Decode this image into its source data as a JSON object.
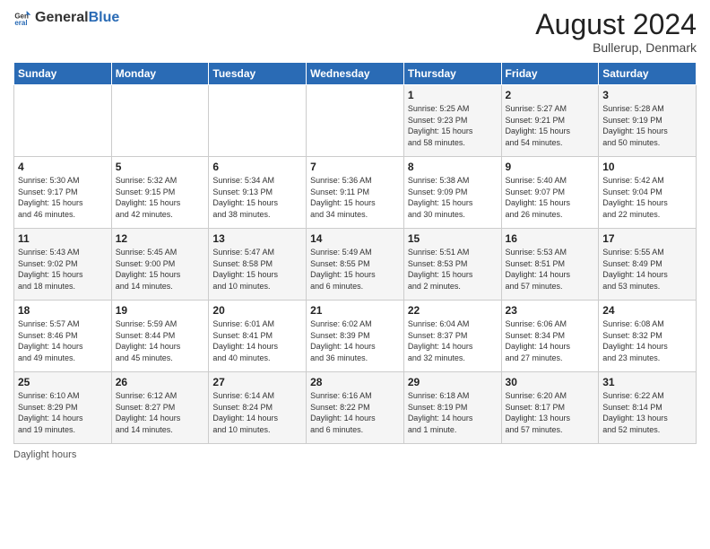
{
  "header": {
    "logo_general": "General",
    "logo_blue": "Blue",
    "month_year": "August 2024",
    "location": "Bullerup, Denmark"
  },
  "footer": {
    "daylight_label": "Daylight hours"
  },
  "days_of_week": [
    "Sunday",
    "Monday",
    "Tuesday",
    "Wednesday",
    "Thursday",
    "Friday",
    "Saturday"
  ],
  "weeks": [
    [
      {
        "day": "",
        "info": ""
      },
      {
        "day": "",
        "info": ""
      },
      {
        "day": "",
        "info": ""
      },
      {
        "day": "",
        "info": ""
      },
      {
        "day": "1",
        "info": "Sunrise: 5:25 AM\nSunset: 9:23 PM\nDaylight: 15 hours\nand 58 minutes."
      },
      {
        "day": "2",
        "info": "Sunrise: 5:27 AM\nSunset: 9:21 PM\nDaylight: 15 hours\nand 54 minutes."
      },
      {
        "day": "3",
        "info": "Sunrise: 5:28 AM\nSunset: 9:19 PM\nDaylight: 15 hours\nand 50 minutes."
      }
    ],
    [
      {
        "day": "4",
        "info": "Sunrise: 5:30 AM\nSunset: 9:17 PM\nDaylight: 15 hours\nand 46 minutes."
      },
      {
        "day": "5",
        "info": "Sunrise: 5:32 AM\nSunset: 9:15 PM\nDaylight: 15 hours\nand 42 minutes."
      },
      {
        "day": "6",
        "info": "Sunrise: 5:34 AM\nSunset: 9:13 PM\nDaylight: 15 hours\nand 38 minutes."
      },
      {
        "day": "7",
        "info": "Sunrise: 5:36 AM\nSunset: 9:11 PM\nDaylight: 15 hours\nand 34 minutes."
      },
      {
        "day": "8",
        "info": "Sunrise: 5:38 AM\nSunset: 9:09 PM\nDaylight: 15 hours\nand 30 minutes."
      },
      {
        "day": "9",
        "info": "Sunrise: 5:40 AM\nSunset: 9:07 PM\nDaylight: 15 hours\nand 26 minutes."
      },
      {
        "day": "10",
        "info": "Sunrise: 5:42 AM\nSunset: 9:04 PM\nDaylight: 15 hours\nand 22 minutes."
      }
    ],
    [
      {
        "day": "11",
        "info": "Sunrise: 5:43 AM\nSunset: 9:02 PM\nDaylight: 15 hours\nand 18 minutes."
      },
      {
        "day": "12",
        "info": "Sunrise: 5:45 AM\nSunset: 9:00 PM\nDaylight: 15 hours\nand 14 minutes."
      },
      {
        "day": "13",
        "info": "Sunrise: 5:47 AM\nSunset: 8:58 PM\nDaylight: 15 hours\nand 10 minutes."
      },
      {
        "day": "14",
        "info": "Sunrise: 5:49 AM\nSunset: 8:55 PM\nDaylight: 15 hours\nand 6 minutes."
      },
      {
        "day": "15",
        "info": "Sunrise: 5:51 AM\nSunset: 8:53 PM\nDaylight: 15 hours\nand 2 minutes."
      },
      {
        "day": "16",
        "info": "Sunrise: 5:53 AM\nSunset: 8:51 PM\nDaylight: 14 hours\nand 57 minutes."
      },
      {
        "day": "17",
        "info": "Sunrise: 5:55 AM\nSunset: 8:49 PM\nDaylight: 14 hours\nand 53 minutes."
      }
    ],
    [
      {
        "day": "18",
        "info": "Sunrise: 5:57 AM\nSunset: 8:46 PM\nDaylight: 14 hours\nand 49 minutes."
      },
      {
        "day": "19",
        "info": "Sunrise: 5:59 AM\nSunset: 8:44 PM\nDaylight: 14 hours\nand 45 minutes."
      },
      {
        "day": "20",
        "info": "Sunrise: 6:01 AM\nSunset: 8:41 PM\nDaylight: 14 hours\nand 40 minutes."
      },
      {
        "day": "21",
        "info": "Sunrise: 6:02 AM\nSunset: 8:39 PM\nDaylight: 14 hours\nand 36 minutes."
      },
      {
        "day": "22",
        "info": "Sunrise: 6:04 AM\nSunset: 8:37 PM\nDaylight: 14 hours\nand 32 minutes."
      },
      {
        "day": "23",
        "info": "Sunrise: 6:06 AM\nSunset: 8:34 PM\nDaylight: 14 hours\nand 27 minutes."
      },
      {
        "day": "24",
        "info": "Sunrise: 6:08 AM\nSunset: 8:32 PM\nDaylight: 14 hours\nand 23 minutes."
      }
    ],
    [
      {
        "day": "25",
        "info": "Sunrise: 6:10 AM\nSunset: 8:29 PM\nDaylight: 14 hours\nand 19 minutes."
      },
      {
        "day": "26",
        "info": "Sunrise: 6:12 AM\nSunset: 8:27 PM\nDaylight: 14 hours\nand 14 minutes."
      },
      {
        "day": "27",
        "info": "Sunrise: 6:14 AM\nSunset: 8:24 PM\nDaylight: 14 hours\nand 10 minutes."
      },
      {
        "day": "28",
        "info": "Sunrise: 6:16 AM\nSunset: 8:22 PM\nDaylight: 14 hours\nand 6 minutes."
      },
      {
        "day": "29",
        "info": "Sunrise: 6:18 AM\nSunset: 8:19 PM\nDaylight: 14 hours\nand 1 minute."
      },
      {
        "day": "30",
        "info": "Sunrise: 6:20 AM\nSunset: 8:17 PM\nDaylight: 13 hours\nand 57 minutes."
      },
      {
        "day": "31",
        "info": "Sunrise: 6:22 AM\nSunset: 8:14 PM\nDaylight: 13 hours\nand 52 minutes."
      }
    ]
  ]
}
